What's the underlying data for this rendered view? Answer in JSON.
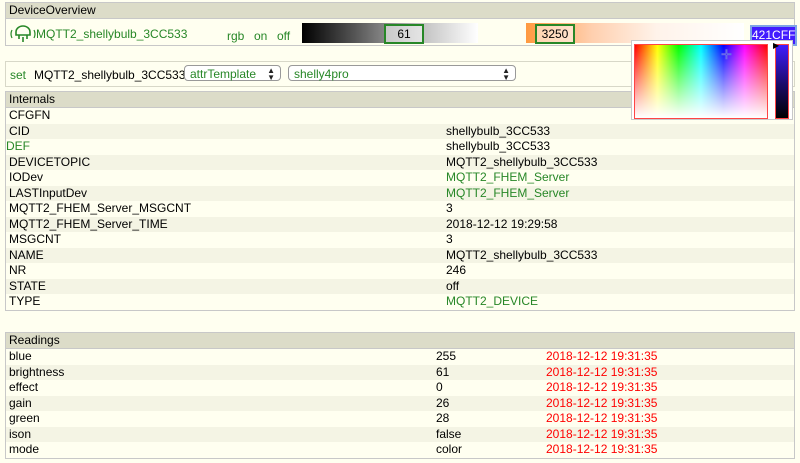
{
  "overview": {
    "header": "DeviceOverview",
    "device_link": "MQTT2_shellybulb_3CC533",
    "cmd_rgb": "rgb",
    "cmd_on": "on",
    "cmd_off": "off",
    "dim_value": "61",
    "ct_value": "3250",
    "color_value": "421CFF",
    "color_hex": "#421cff",
    "bulb_icon": "light-bulb-icon"
  },
  "setrow": {
    "set_label": "set",
    "device": "MQTT2_shellybulb_3CC533",
    "select1": "attrTemplate",
    "select2": "shelly4pro"
  },
  "internals": {
    "header": "Internals",
    "rows": [
      {
        "name": "CFGFN",
        "value": ""
      },
      {
        "name": "CID",
        "value": "shellybulb_3CC533"
      },
      {
        "name": "DEF",
        "value": "shellybulb_3CC533"
      },
      {
        "name": "DEVICETOPIC",
        "value": "MQTT2_shellybulb_3CC533"
      },
      {
        "name": "IODev",
        "value": "MQTT2_FHEM_Server"
      },
      {
        "name": "LASTInputDev",
        "value": "MQTT2_FHEM_Server"
      },
      {
        "name": "MQTT2_FHEM_Server_MSGCNT",
        "value": "3"
      },
      {
        "name": "MQTT2_FHEM_Server_TIME",
        "value": "2018-12-12 19:29:58"
      },
      {
        "name": "MSGCNT",
        "value": "3"
      },
      {
        "name": "NAME",
        "value": "MQTT2_shellybulb_3CC533"
      },
      {
        "name": "NR",
        "value": "246"
      },
      {
        "name": "STATE",
        "value": "off"
      },
      {
        "name": "TYPE",
        "value": "MQTT2_DEVICE"
      }
    ]
  },
  "readings": {
    "header": "Readings",
    "rows": [
      {
        "name": "blue",
        "value": "255",
        "time": "2018-12-12 19:31:35"
      },
      {
        "name": "brightness",
        "value": "61",
        "time": "2018-12-12 19:31:35"
      },
      {
        "name": "effect",
        "value": "0",
        "time": "2018-12-12 19:31:35"
      },
      {
        "name": "gain",
        "value": "26",
        "time": "2018-12-12 19:31:35"
      },
      {
        "name": "green",
        "value": "28",
        "time": "2018-12-12 19:31:35"
      },
      {
        "name": "ison",
        "value": "false",
        "time": "2018-12-12 19:31:35"
      },
      {
        "name": "mode",
        "value": "color",
        "time": "2018-12-12 19:31:35"
      }
    ]
  },
  "colors": {
    "link_green": "#278727",
    "timestamp_red": "#ff0000",
    "header_bg": "#dcdcc8",
    "page_bg": "#fffff0"
  }
}
